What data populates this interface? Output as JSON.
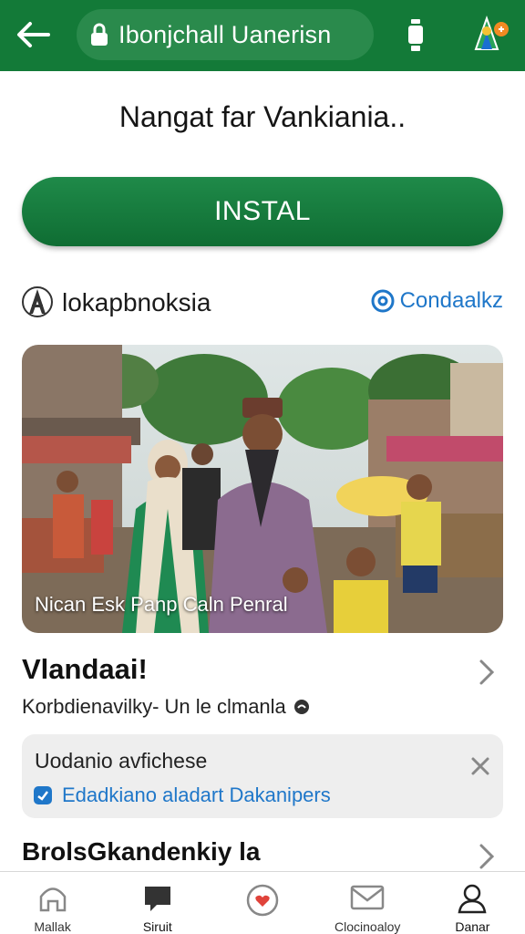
{
  "browser": {
    "url_text": "Ibonjchall Uanerisn"
  },
  "page": {
    "title": "Nangat far Vankiania..",
    "install_label": "INSTAL"
  },
  "publisher": {
    "name": "lokapbnoksia",
    "contact_label": "Condaalkz"
  },
  "hero": {
    "caption": "Nican Esk Panp Caln Penral"
  },
  "section1": {
    "title": "Vlandaai!",
    "subtitle": "Korbdienavilky- Un le clmanla"
  },
  "info_card": {
    "title": "Uodanio avfichese",
    "link_label": "Edadkiano aladart Dakanipers"
  },
  "section2": {
    "title": "BrolsGkandenkiy la"
  },
  "bottom_nav": {
    "items": [
      {
        "label": "Mallak",
        "icon": "home-icon"
      },
      {
        "label": "Siruit",
        "icon": "chat-icon"
      },
      {
        "label": "",
        "icon": "heart-badge-icon"
      },
      {
        "label": "Clocinoaloy",
        "icon": "mail-icon"
      },
      {
        "label": "Danar",
        "icon": "user-icon"
      }
    ]
  },
  "colors": {
    "brand_green": "#137a38",
    "link_blue": "#1f77c9"
  }
}
